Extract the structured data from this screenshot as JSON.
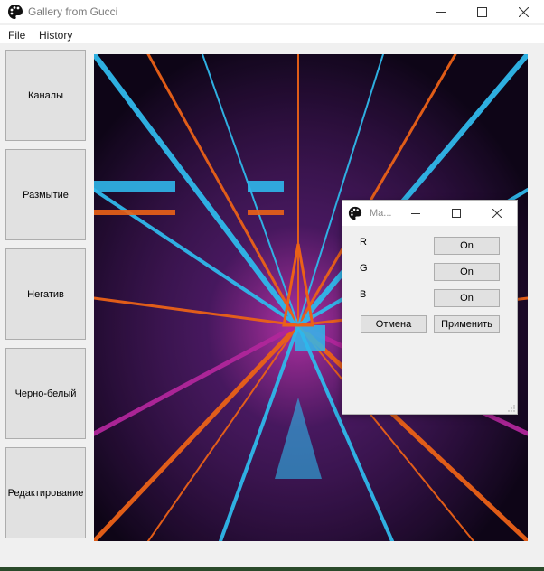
{
  "window": {
    "title": "Gallery from Gucci"
  },
  "menu": {
    "file": "File",
    "history": "History"
  },
  "sidebar": {
    "items": [
      {
        "label": "Каналы"
      },
      {
        "label": "Размытие"
      },
      {
        "label": "Негатив"
      },
      {
        "label": "Черно-белый"
      },
      {
        "label": "Редактирование"
      }
    ]
  },
  "dialog": {
    "title": "Ma...",
    "channels": [
      {
        "name": "R",
        "state": "On"
      },
      {
        "name": "G",
        "state": "On"
      },
      {
        "name": "B",
        "state": "On"
      }
    ],
    "cancel_label": "Отмена",
    "apply_label": "Применить"
  },
  "colors": {
    "neon_cyan": "#34c8ff",
    "neon_orange": "#ff6a1a",
    "neon_magenta": "#c02aa8",
    "bg_dark": "#1a0a22"
  },
  "icons": {
    "app": "palette-icon",
    "minimize": "minimize-icon",
    "maximize": "maximize-icon",
    "close": "close-icon"
  }
}
